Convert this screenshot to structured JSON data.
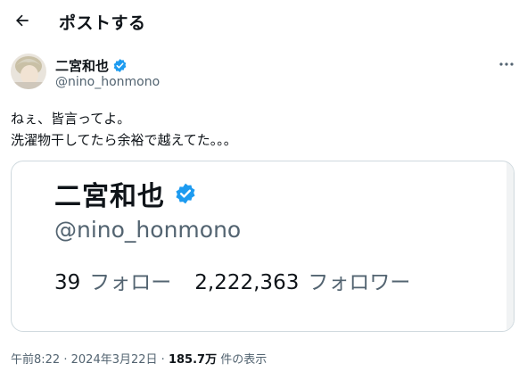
{
  "header": {
    "title": "ポストする",
    "back_icon": "arrow-left-icon"
  },
  "author": {
    "name": "二宮和也",
    "handle": "@nino_honmono",
    "verified": true,
    "verified_color": "#1d9bf0"
  },
  "post": {
    "lines": [
      "ねぇ、皆言ってよ。",
      "洗濯物干してたら余裕で越えてた。。。"
    ]
  },
  "card": {
    "name": "二宮和也",
    "handle": "@nino_honmono",
    "following_count": "39",
    "following_label": "フォロー",
    "followers_count": "2,222,363",
    "followers_label": "フォロワー"
  },
  "meta": {
    "time": "午前8:22",
    "separator": "·",
    "date": "2024年3月22日",
    "views_count": "185.7万",
    "views_label": "件の表示"
  }
}
